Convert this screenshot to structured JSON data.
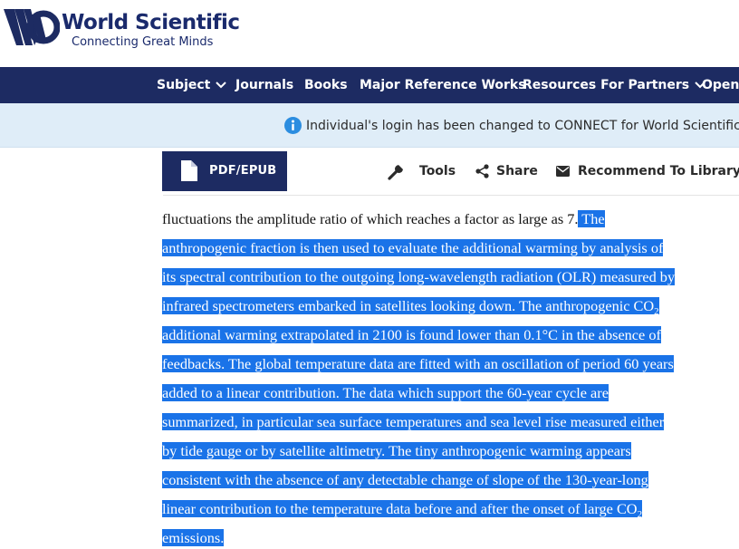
{
  "brand": {
    "name": "World Scientific",
    "tagline": "Connecting Great Minds"
  },
  "nav": {
    "items": [
      {
        "label": "Subject",
        "dropdown": true
      },
      {
        "label": "Journals",
        "dropdown": false
      },
      {
        "label": "Books",
        "dropdown": false
      },
      {
        "label": "Major Reference Works",
        "dropdown": false
      },
      {
        "label": "Resources For Partners",
        "dropdown": true
      },
      {
        "label": "Open",
        "dropdown": false
      }
    ]
  },
  "banner": {
    "text": "Individual's login has been changed to CONNECT for World Scientific with",
    "icon": "info-icon"
  },
  "toolbar": {
    "pdf_label": "PDF/EPUB",
    "tools_label": "Tools",
    "share_label": "Share",
    "recommend_label": "Recommend To Library"
  },
  "abstract": {
    "lines": [
      {
        "plain": "fluctuations the amplitude ratio of which reaches a factor as large as 7.",
        "sel": " The",
        "sub": ""
      },
      {
        "plain": "",
        "sel": "anthropogenic fraction is then used to evaluate the additional warming by analysis of",
        "sub": ""
      },
      {
        "plain": "",
        "sel": "its spectral contribution to the outgoing long-wavelength radiation (OLR) measured by",
        "sub": ""
      },
      {
        "plain": "",
        "sel": "infrared spectrometers embarked in satellites looking down. The anthropogenic CO",
        "sub": "2"
      },
      {
        "plain": "",
        "sel": "additional warming extrapolated in 2100 is found lower than 0.1°C in the absence of",
        "sub": ""
      },
      {
        "plain": "",
        "sel": "feedbacks. The global temperature data are fitted with an oscillation of period 60 years",
        "sub": ""
      },
      {
        "plain": "",
        "sel": "added to a linear contribution. The data which support the 60-year cycle are",
        "sub": ""
      },
      {
        "plain": "",
        "sel": "summarized, in particular sea surface temperatures and sea level rise measured either",
        "sub": ""
      },
      {
        "plain": "",
        "sel": "by tide gauge or by satellite altimetry. The tiny anthropogenic warming appears",
        "sub": ""
      },
      {
        "plain": "",
        "sel": "consistent with the absence of any detectable change of slope of the 130-year-long",
        "sub": ""
      },
      {
        "plain": "",
        "sel": "linear contribution to the temperature data before and after the onset of large CO",
        "sub": "2"
      },
      {
        "plain": "",
        "sel": "emissions.",
        "sub": ""
      }
    ]
  },
  "colors": {
    "brand_navy": "#1d2b62",
    "banner_bg": "#dfedf8",
    "selection": "#1a73e8",
    "info_blue": "#2b8de0"
  }
}
